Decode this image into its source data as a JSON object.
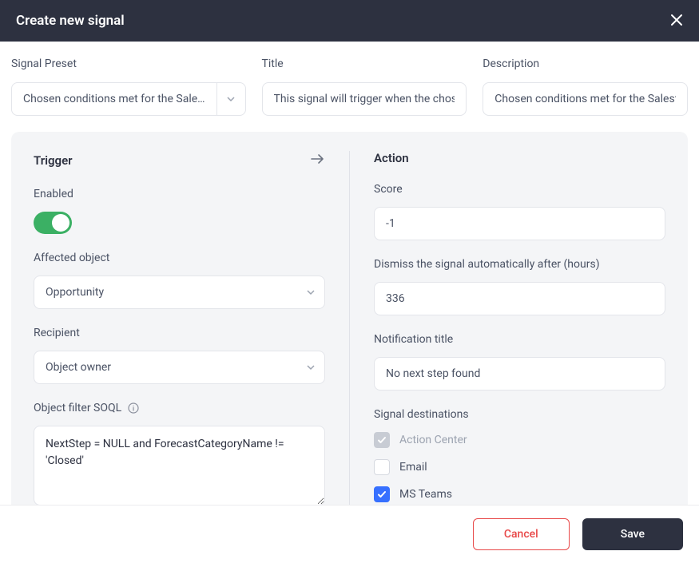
{
  "header": {
    "title": "Create new signal"
  },
  "top": {
    "preset_label": "Signal Preset",
    "preset_value": "Chosen conditions met for the Sale…",
    "title_label": "Title",
    "title_value": "This signal will trigger when the chosen",
    "desc_label": "Description",
    "desc_value": "Chosen conditions met for the Salesforce"
  },
  "trigger": {
    "section": "Trigger",
    "enabled_label": "Enabled",
    "enabled": true,
    "affected_label": "Affected object",
    "affected_value": "Opportunity",
    "recipient_label": "Recipient",
    "recipient_value": "Object owner",
    "soql_label": "Object filter SOQL",
    "soql_value": "NextStep = NULL and ForecastCategoryName != 'Closed'"
  },
  "action": {
    "section": "Action",
    "score_label": "Score",
    "score_value": "-1",
    "dismiss_label": "Dismiss the signal automatically after (hours)",
    "dismiss_value": "336",
    "notif_title_label": "Notification title",
    "notif_title_value": "No next step found",
    "destinations_label": "Signal destinations",
    "dest": {
      "action_center": "Action Center",
      "email": "Email",
      "ms_teams": "MS Teams"
    }
  },
  "footer": {
    "cancel": "Cancel",
    "save": "Save"
  }
}
